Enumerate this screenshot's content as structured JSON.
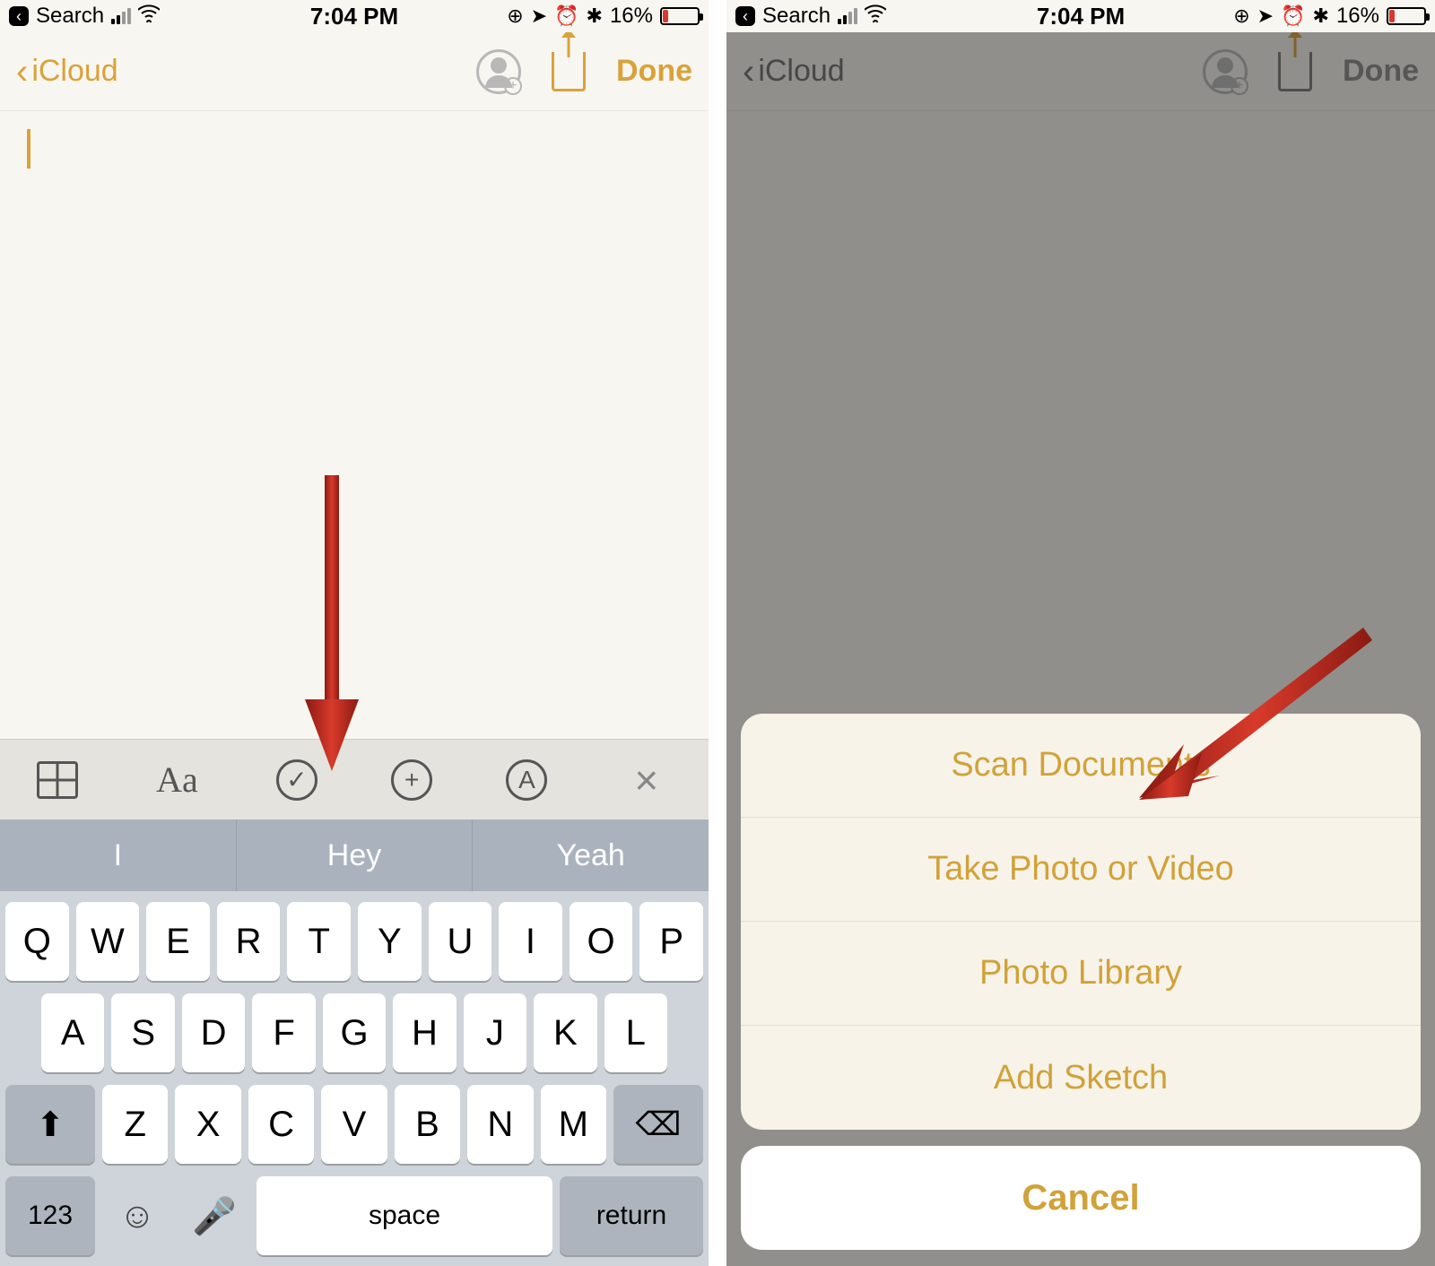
{
  "status": {
    "back_app": "Search",
    "time": "7:04 PM",
    "battery_pct": "16%"
  },
  "nav": {
    "back_label": "iCloud",
    "done_label": "Done"
  },
  "toolbar": {
    "aa": "Aa",
    "check": "✓",
    "plus": "+",
    "pen": "A",
    "close": "×"
  },
  "quicktype": [
    "I",
    "Hey",
    "Yeah"
  ],
  "keyboard": {
    "row1": [
      "Q",
      "W",
      "E",
      "R",
      "T",
      "Y",
      "U",
      "I",
      "O",
      "P"
    ],
    "row2": [
      "A",
      "S",
      "D",
      "F",
      "G",
      "H",
      "J",
      "K",
      "L"
    ],
    "row3": [
      "Z",
      "X",
      "C",
      "V",
      "B",
      "N",
      "M"
    ],
    "num": "123",
    "space": "space",
    "return": "return"
  },
  "sheet": {
    "items": [
      "Scan Documents",
      "Take Photo or Video",
      "Photo Library",
      "Add Sketch"
    ],
    "cancel": "Cancel"
  }
}
